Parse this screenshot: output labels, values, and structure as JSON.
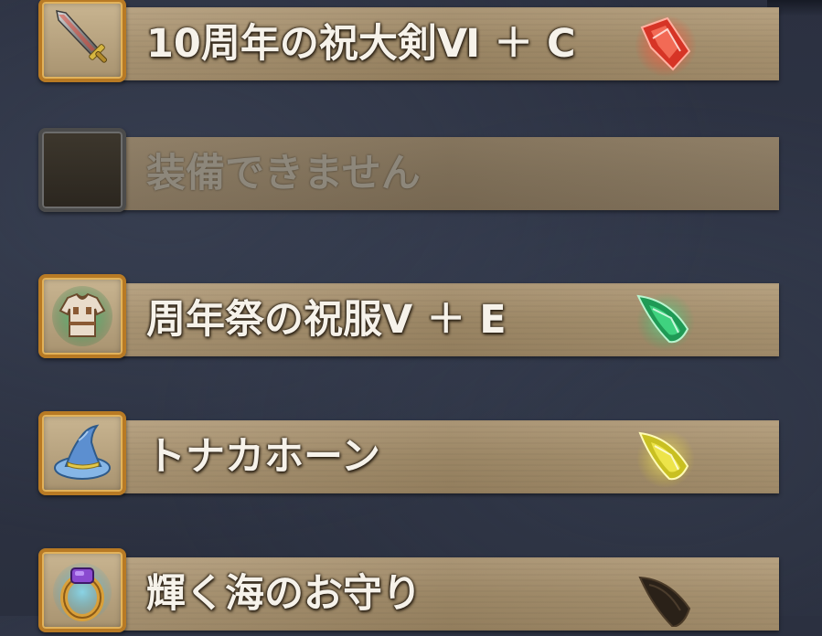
{
  "equipment_slots": [
    {
      "name": "10周年の祝大剣Ⅵ ＋ C",
      "item_icon": "greatsword-icon",
      "gem_icon": "red-gem-icon",
      "gem_color": "#e2412f",
      "equippable": true
    },
    {
      "name": "装備できません",
      "item_icon": "empty-slot",
      "gem_icon": "",
      "gem_color": "",
      "equippable": false
    },
    {
      "name": "周年祭の祝服Ⅴ ＋ E",
      "item_icon": "tunic-icon",
      "gem_icon": "green-gem-icon",
      "gem_color": "#2fb86a",
      "equippable": true
    },
    {
      "name": "トナカホーン",
      "item_icon": "wizard-hat-icon",
      "gem_icon": "yellow-gem-icon",
      "gem_color": "#e6df34",
      "equippable": true
    },
    {
      "name": "輝く海のお守り",
      "item_icon": "ring-icon",
      "gem_icon": "black-gem-icon",
      "gem_color": "#2a2118",
      "equippable": true
    }
  ]
}
